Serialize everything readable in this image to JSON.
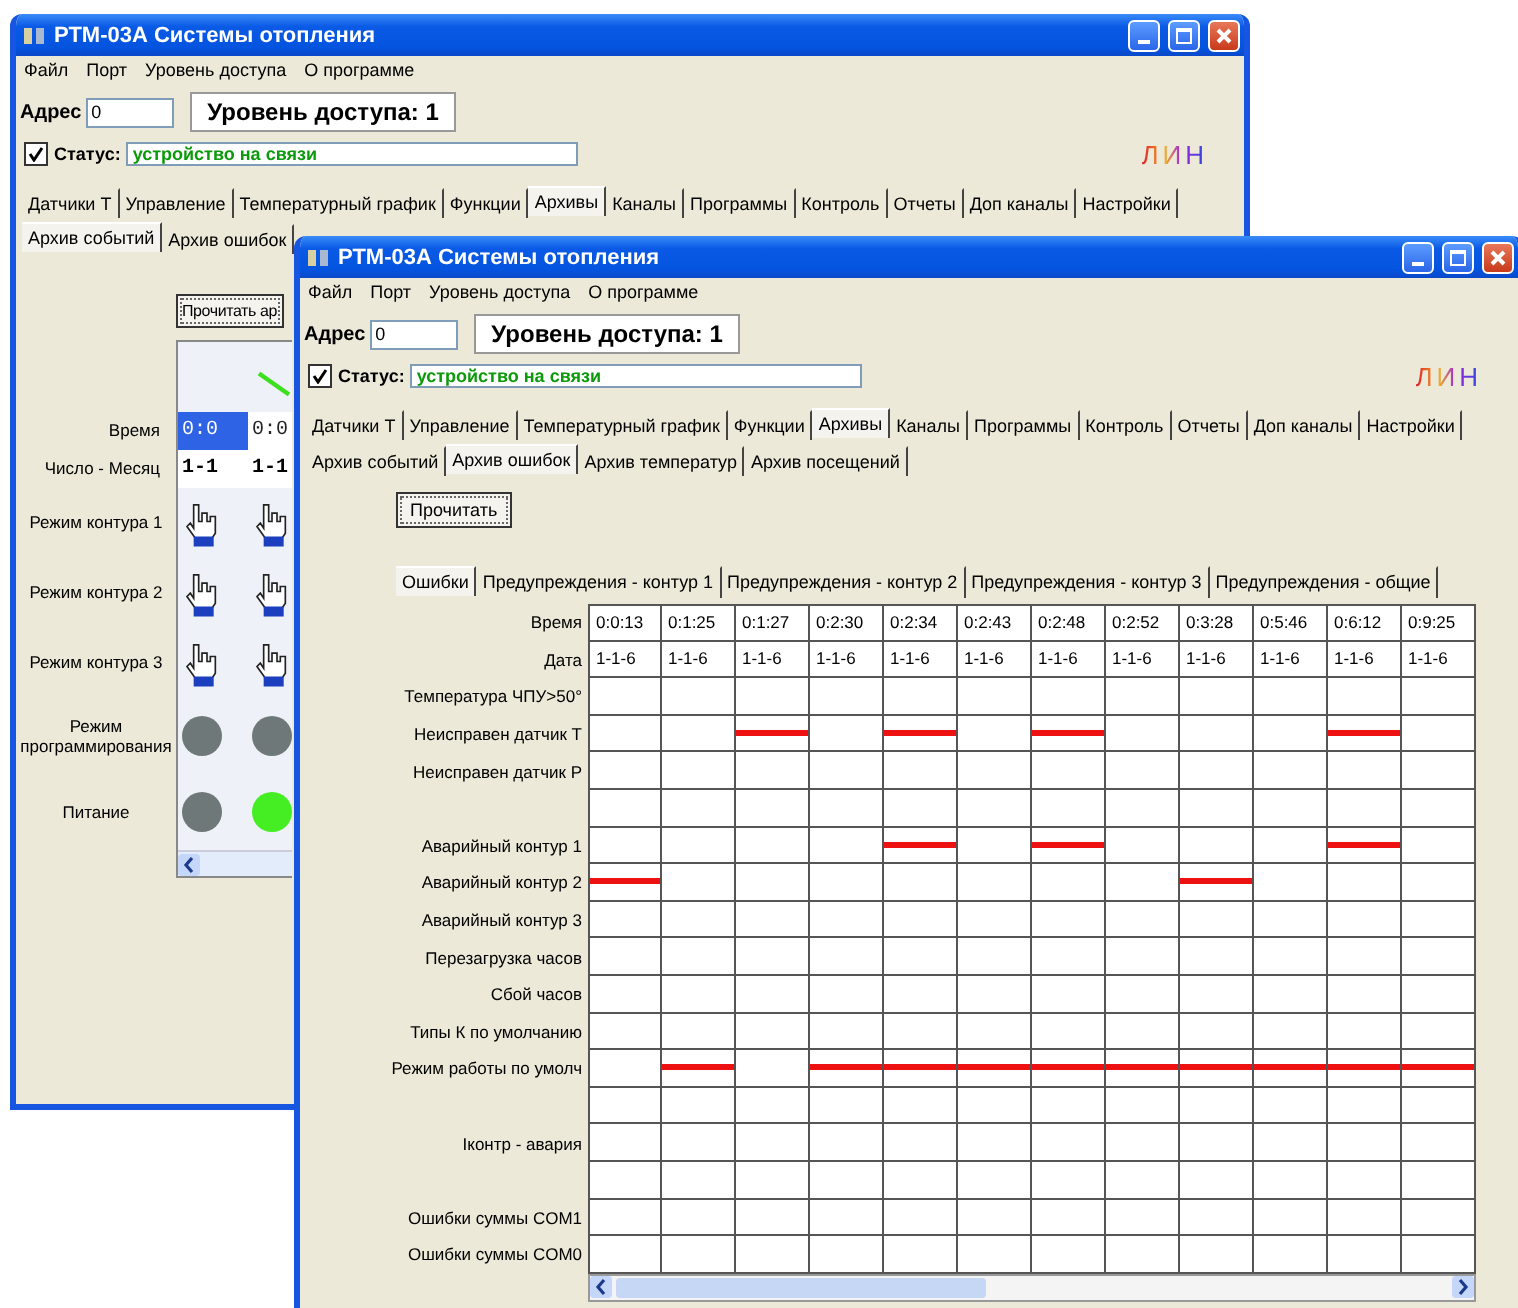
{
  "back_window": {
    "title": "РТМ-03А Системы отопления",
    "menu": [
      "Файл",
      "Порт",
      "Уровень доступа",
      "О программе"
    ],
    "address": {
      "label": "Адрес",
      "value": "0"
    },
    "access_level": "Уровень доступа: 1",
    "status": {
      "label": "Статус:",
      "value": "устройство на связи",
      "checked": true
    },
    "logo": "ЛИН",
    "tabs": [
      {
        "label": "Датчики Т",
        "selected": false
      },
      {
        "label": "Управление",
        "selected": false
      },
      {
        "label": "Температурный график",
        "selected": false
      },
      {
        "label": "Функции",
        "selected": false
      },
      {
        "label": "Архивы",
        "selected": true
      },
      {
        "label": "Каналы",
        "selected": false
      },
      {
        "label": "Программы",
        "selected": false
      },
      {
        "label": "Контроль",
        "selected": false
      },
      {
        "label": "Отчеты",
        "selected": false
      },
      {
        "label": "Доп каналы",
        "selected": false
      },
      {
        "label": "Настройки",
        "selected": false
      }
    ],
    "subtabs": [
      {
        "label": "Архив событий",
        "selected": true
      },
      {
        "label": "Архив ошибок",
        "selected": false
      }
    ],
    "read_button": "Прочитать ар",
    "row_labels": [
      "Время",
      "Число - Месяц",
      "Режим контура 1",
      "Режим контура 2",
      "Режим контура 3",
      "Режим программирования",
      "Питание"
    ],
    "columns": [
      {
        "time": "0:0",
        "date": "1-1",
        "selected": true,
        "programming": false,
        "power": false
      },
      {
        "time": "0:0",
        "date": "1-1",
        "selected": false,
        "programming": false,
        "power": true
      }
    ]
  },
  "front_window": {
    "title": "РТМ-03А Системы отопления",
    "menu": [
      "Файл",
      "Порт",
      "Уровень доступа",
      "О программе"
    ],
    "address": {
      "label": "Адрес",
      "value": "0"
    },
    "access_level": "Уровень доступа: 1",
    "status": {
      "label": "Статус:",
      "value": "устройство на связи",
      "checked": true
    },
    "logo": "ЛИН",
    "tabs": [
      {
        "label": "Датчики Т",
        "selected": false
      },
      {
        "label": "Управление",
        "selected": false
      },
      {
        "label": "Температурный график",
        "selected": false
      },
      {
        "label": "Функции",
        "selected": false
      },
      {
        "label": "Архивы",
        "selected": true
      },
      {
        "label": "Каналы",
        "selected": false
      },
      {
        "label": "Программы",
        "selected": false
      },
      {
        "label": "Контроль",
        "selected": false
      },
      {
        "label": "Отчеты",
        "selected": false
      },
      {
        "label": "Доп каналы",
        "selected": false
      },
      {
        "label": "Настройки",
        "selected": false
      }
    ],
    "subtabs": [
      {
        "label": "Архив событий",
        "selected": false
      },
      {
        "label": "Архив ошибок",
        "selected": true
      },
      {
        "label": "Архив температур",
        "selected": false
      },
      {
        "label": "Архив посещений",
        "selected": false
      }
    ],
    "read_button": "Прочитать",
    "error_tabs": [
      {
        "label": "Ошибки",
        "selected": true
      },
      {
        "label": "Предупреждения - контур 1",
        "selected": false
      },
      {
        "label": "Предупреждения - контур 2",
        "selected": false
      },
      {
        "label": "Предупреждения - контур 3",
        "selected": false
      },
      {
        "label": "Предупреждения - общие",
        "selected": false
      }
    ],
    "grid": {
      "time_label": "Время",
      "date_label": "Дата",
      "columns": [
        {
          "time": "0:0:13",
          "date": "1-1-6"
        },
        {
          "time": "0:1:25",
          "date": "1-1-6"
        },
        {
          "time": "0:1:27",
          "date": "1-1-6"
        },
        {
          "time": "0:2:30",
          "date": "1-1-6"
        },
        {
          "time": "0:2:34",
          "date": "1-1-6"
        },
        {
          "time": "0:2:43",
          "date": "1-1-6"
        },
        {
          "time": "0:2:48",
          "date": "1-1-6"
        },
        {
          "time": "0:2:52",
          "date": "1-1-6"
        },
        {
          "time": "0:3:28",
          "date": "1-1-6"
        },
        {
          "time": "0:5:46",
          "date": "1-1-6"
        },
        {
          "time": "0:6:12",
          "date": "1-1-6"
        },
        {
          "time": "0:9:25",
          "date": "1-1-6"
        }
      ],
      "rows": [
        {
          "label": "Температура ЧПУ>50°",
          "marks": [
            false,
            false,
            false,
            false,
            false,
            false,
            false,
            false,
            false,
            false,
            false,
            false
          ]
        },
        {
          "label": "Неисправен датчик Т",
          "marks": [
            false,
            false,
            true,
            false,
            true,
            false,
            true,
            false,
            false,
            false,
            true,
            false
          ]
        },
        {
          "label": "Неисправен датчик Р",
          "marks": [
            false,
            false,
            false,
            false,
            false,
            false,
            false,
            false,
            false,
            false,
            false,
            false
          ]
        },
        {
          "marks": [
            false,
            false,
            false,
            false,
            false,
            false,
            false,
            false,
            false,
            false,
            false,
            false
          ]
        },
        {
          "label": "Аварийный контур 1",
          "marks": [
            false,
            false,
            false,
            false,
            true,
            false,
            true,
            false,
            false,
            false,
            true,
            false
          ]
        },
        {
          "label": "Аварийный контур 2",
          "marks": [
            true,
            false,
            false,
            false,
            false,
            false,
            false,
            false,
            true,
            false,
            false,
            false
          ]
        },
        {
          "label": "Аварийный контур 3",
          "marks": [
            false,
            false,
            false,
            false,
            false,
            false,
            false,
            false,
            false,
            false,
            false,
            false
          ]
        },
        {
          "label": "Перезагрузка часов",
          "marks": [
            false,
            false,
            false,
            false,
            false,
            false,
            false,
            false,
            false,
            false,
            false,
            false
          ]
        },
        {
          "label": "Сбой часов",
          "marks": [
            false,
            false,
            false,
            false,
            false,
            false,
            false,
            false,
            false,
            false,
            false,
            false
          ]
        },
        {
          "label": "Типы К по умолчанию",
          "marks": [
            false,
            false,
            false,
            false,
            false,
            false,
            false,
            false,
            false,
            false,
            false,
            false
          ]
        },
        {
          "label": "Режим работы по умолч",
          "marks": [
            false,
            true,
            false,
            true,
            true,
            true,
            true,
            true,
            true,
            true,
            true,
            true
          ]
        },
        {
          "marks": [
            false,
            false,
            false,
            false,
            false,
            false,
            false,
            false,
            false,
            false,
            false,
            false
          ]
        },
        {
          "label": "Iконтр - авария",
          "marks": [
            false,
            false,
            false,
            false,
            false,
            false,
            false,
            false,
            false,
            false,
            false,
            false
          ]
        },
        {
          "marks": [
            false,
            false,
            false,
            false,
            false,
            false,
            false,
            false,
            false,
            false,
            false,
            false
          ]
        },
        {
          "label": "Ошибки суммы COM1",
          "marks": [
            false,
            false,
            false,
            false,
            false,
            false,
            false,
            false,
            false,
            false,
            false,
            false
          ]
        },
        {
          "label": "Ошибки суммы COM0",
          "marks": [
            false,
            false,
            false,
            false,
            false,
            false,
            false,
            false,
            false,
            false,
            false,
            false
          ]
        }
      ]
    }
  }
}
